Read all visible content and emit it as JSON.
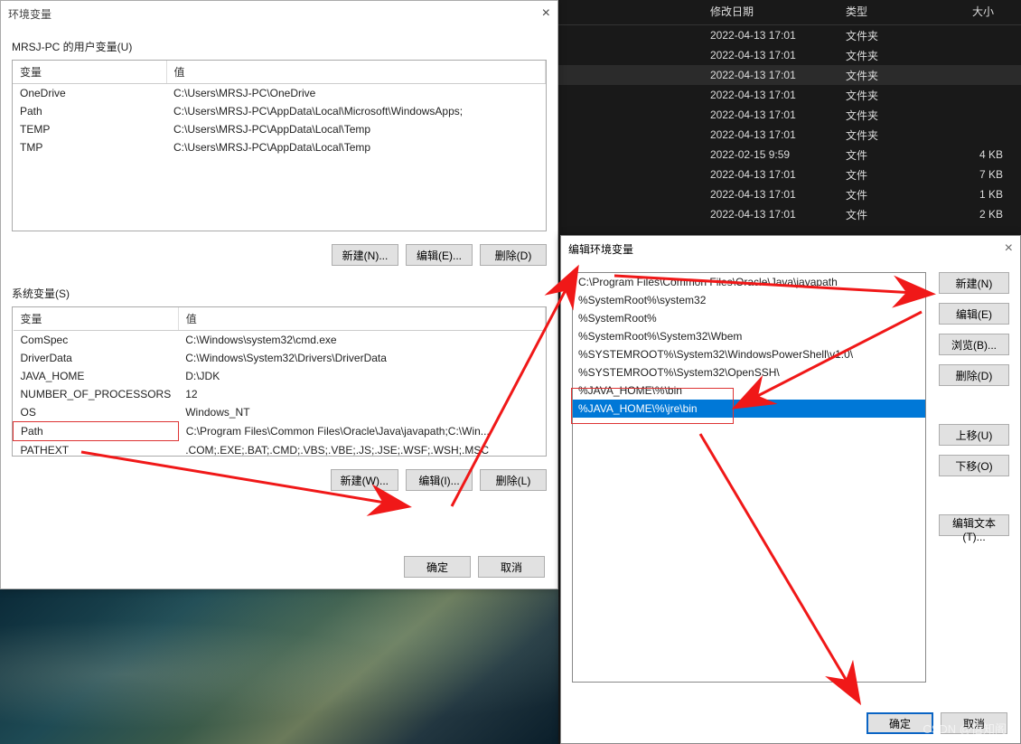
{
  "env_dialog": {
    "title": "环境变量",
    "user_vars_label": "MRSJ-PC 的用户变量(U)",
    "col_var": "变量",
    "col_val": "值",
    "user_vars": [
      {
        "name": "OneDrive",
        "value": "C:\\Users\\MRSJ-PC\\OneDrive"
      },
      {
        "name": "Path",
        "value": "C:\\Users\\MRSJ-PC\\AppData\\Local\\Microsoft\\WindowsApps;"
      },
      {
        "name": "TEMP",
        "value": "C:\\Users\\MRSJ-PC\\AppData\\Local\\Temp"
      },
      {
        "name": "TMP",
        "value": "C:\\Users\\MRSJ-PC\\AppData\\Local\\Temp"
      }
    ],
    "btn_new_u": "新建(N)...",
    "btn_edit_u": "编辑(E)...",
    "btn_del_u": "删除(D)",
    "sys_vars_label": "系统变量(S)",
    "sys_vars": [
      {
        "name": "ComSpec",
        "value": "C:\\Windows\\system32\\cmd.exe"
      },
      {
        "name": "DriverData",
        "value": "C:\\Windows\\System32\\Drivers\\DriverData"
      },
      {
        "name": "JAVA_HOME",
        "value": "D:\\JDK"
      },
      {
        "name": "NUMBER_OF_PROCESSORS",
        "value": "12"
      },
      {
        "name": "OS",
        "value": "Windows_NT"
      },
      {
        "name": "Path",
        "value": "C:\\Program Files\\Common Files\\Oracle\\Java\\javapath;C:\\Win..."
      },
      {
        "name": "PATHEXT",
        "value": ".COM;.EXE;.BAT;.CMD;.VBS;.VBE;.JS;.JSE;.WSF;.WSH;.MSC"
      }
    ],
    "btn_new_s": "新建(W)...",
    "btn_edit_s": "编辑(I)...",
    "btn_del_s": "删除(L)",
    "ok": "确定",
    "cancel": "取消"
  },
  "explorer": {
    "col_date": "修改日期",
    "col_type": "类型",
    "col_size": "大小",
    "rows": [
      {
        "date": "2022-04-13 17:01",
        "type": "文件夹",
        "size": ""
      },
      {
        "date": "2022-04-13 17:01",
        "type": "文件夹",
        "size": ""
      },
      {
        "date": "2022-04-13 17:01",
        "type": "文件夹",
        "size": "",
        "selected": true
      },
      {
        "date": "2022-04-13 17:01",
        "type": "文件夹",
        "size": ""
      },
      {
        "date": "2022-04-13 17:01",
        "type": "文件夹",
        "size": ""
      },
      {
        "date": "2022-04-13 17:01",
        "type": "文件夹",
        "size": ""
      },
      {
        "date": "2022-02-15 9:59",
        "type": "文件",
        "size": "4 KB"
      },
      {
        "date": "2022-04-13 17:01",
        "type": "文件",
        "size": "7 KB"
      },
      {
        "date": "2022-04-13 17:01",
        "type": "文件",
        "size": "1 KB"
      },
      {
        "date": "2022-04-13 17:01",
        "type": "文件",
        "size": "2 KB"
      }
    ]
  },
  "edit_dialog": {
    "title": "编辑环境变量",
    "entries": [
      "C:\\Program Files\\Common Files\\Oracle\\Java\\javapath",
      "%SystemRoot%\\system32",
      "%SystemRoot%",
      "%SystemRoot%\\System32\\Wbem",
      "%SYSTEMROOT%\\System32\\WindowsPowerShell\\v1.0\\",
      "%SYSTEMROOT%\\System32\\OpenSSH\\",
      "%JAVA_HOME\\%\\bin",
      "%JAVA_HOME\\%\\jre\\bin"
    ],
    "btn_new": "新建(N)",
    "btn_edit": "编辑(E)",
    "btn_browse": "浏览(B)...",
    "btn_del": "删除(D)",
    "btn_up": "上移(U)",
    "btn_down": "下移(O)",
    "btn_edit_text": "编辑文本(T)...",
    "ok": "确定",
    "cancel": "取消"
  },
  "watermark": "CSDN @信知阁"
}
